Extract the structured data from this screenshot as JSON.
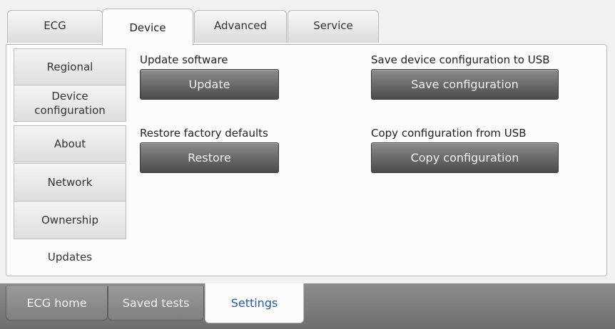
{
  "top_tabs": [
    {
      "label": "ECG"
    },
    {
      "label": "Device"
    },
    {
      "label": "Advanced"
    },
    {
      "label": "Service"
    }
  ],
  "active_top_tab": "Device",
  "side_menu": [
    {
      "label": "Regional"
    },
    {
      "label": "Device configuration"
    },
    {
      "label": "About"
    },
    {
      "label": "Network"
    },
    {
      "label": "Ownership"
    },
    {
      "label": "Updates"
    }
  ],
  "active_side_item": "Updates",
  "sections": {
    "update": {
      "label": "Update software",
      "button": "Update"
    },
    "restore": {
      "label": "Restore factory defaults",
      "button": "Restore"
    },
    "save_config": {
      "label": "Save device configuration to USB",
      "button": "Save configuration"
    },
    "copy_config": {
      "label": "Copy configuration from USB",
      "button": "Copy configuration"
    }
  },
  "bottom_tabs": [
    {
      "label": "ECG home"
    },
    {
      "label": "Saved tests"
    },
    {
      "label": "Settings"
    }
  ],
  "active_bottom_tab": "Settings",
  "colors": {
    "panel_bg": "#fdfbfc",
    "button_dark": "#5a5a5a",
    "active_bottom_text": "#1e5fa6",
    "bottom_bar": "#7d7d7d"
  }
}
